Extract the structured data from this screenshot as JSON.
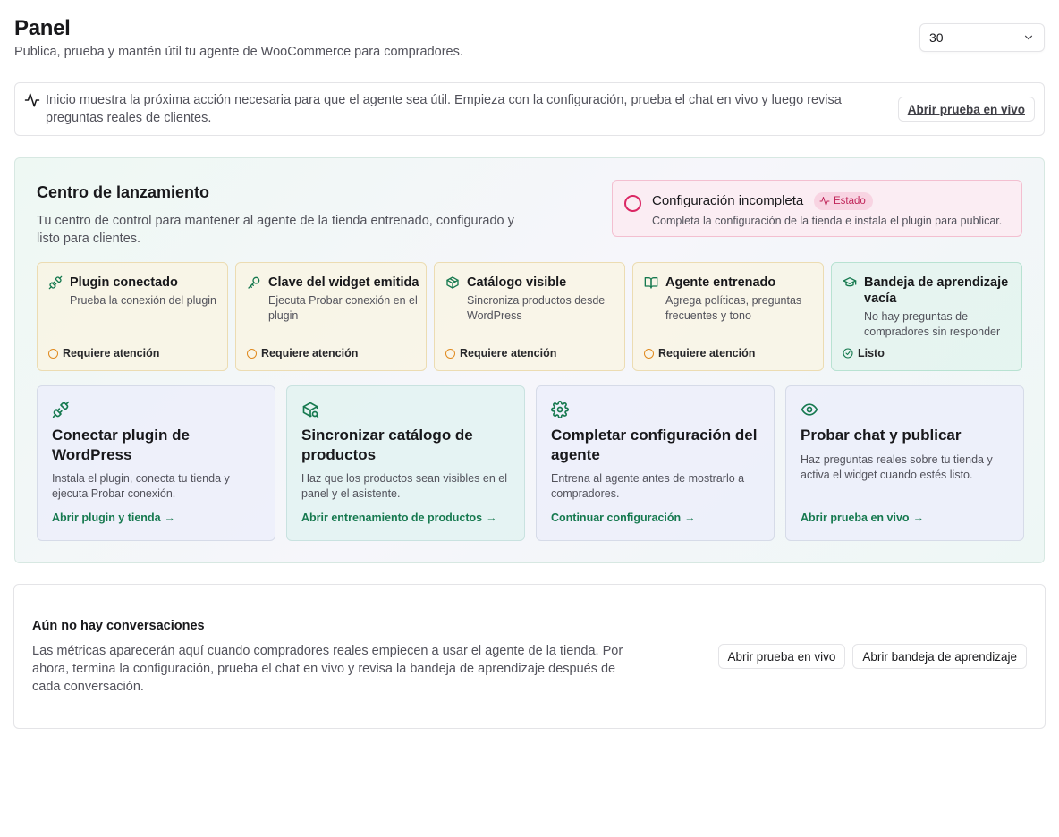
{
  "header": {
    "title": "Panel",
    "subtitle": "Publica, prueba y mantén útil tu agente de WooCommerce para compradores.",
    "range_value": "30"
  },
  "info": {
    "text": "Inicio muestra la próxima acción necesaria para que el agente sea útil. Empieza con la configuración, prueba el chat en vivo y luego revisa preguntas reales de clientes.",
    "button": "Abrir prueba en vivo"
  },
  "launch": {
    "title": "Centro de lanzamiento",
    "description": "Tu centro de control para mantener al agente de la tienda entrenado, configurado y listo para clientes.",
    "status": {
      "title": "Configuración incompleta",
      "badge": "Estado",
      "subtitle": "Completa la configuración de la tienda e instala el plugin para publicar.",
      "color": "#db2764"
    },
    "checks": [
      {
        "icon": "plug-icon",
        "title": "Plugin conectado",
        "description": "Prueba la conexión del plugin",
        "status": "Requiere atención"
      },
      {
        "icon": "key-icon",
        "title": "Clave del widget emitida",
        "description": "Ejecuta Probar conexión en el plugin",
        "status": "Requiere atención"
      },
      {
        "icon": "package-icon",
        "title": "Catálogo visible",
        "description": "Sincroniza productos desde WordPress",
        "status": "Requiere atención"
      },
      {
        "icon": "book-icon",
        "title": "Agente entrenado",
        "description": "Agrega políticas, preguntas frecuentes y tono",
        "status": "Requiere atención"
      },
      {
        "icon": "graduation-cap-icon",
        "title": "Bandeja de aprendizaje vacía",
        "description": "No hay preguntas de compradores sin responder",
        "status": "Listo"
      }
    ],
    "actions": [
      {
        "icon": "plug-icon",
        "title": "Conectar plugin de WordPress",
        "description": "Instala el plugin, conecta tu tienda y ejecuta Probar conexión.",
        "link": "Abrir plugin y tienda"
      },
      {
        "icon": "package-search-icon",
        "title": "Sincronizar catálogo de productos",
        "description": "Haz que los productos sean visibles en el panel y el asistente.",
        "link": "Abrir entrenamiento de productos"
      },
      {
        "icon": "gear-icon",
        "title": "Completar configuración del agente",
        "description": "Entrena al agente antes de mostrarlo a compradores.",
        "link": "Continuar configuración"
      },
      {
        "icon": "eye-icon",
        "title": "Probar chat y publicar",
        "description": "Haz preguntas reales sobre tu tienda y activa el widget cuando estés listo.",
        "link": "Abrir prueba en vivo"
      }
    ],
    "accent_color": "#16794f",
    "warning_color": "#e08a1f"
  },
  "conversations": {
    "title": "Aún no hay conversaciones",
    "description": "Las métricas aparecerán aquí cuando compradores reales empiecen a usar el agente de la tienda. Por ahora, termina la configuración, prueba el chat en vivo y revisa la bandeja de aprendizaje después de cada conversación.",
    "button_live": "Abrir prueba en vivo",
    "button_inbox": "Abrir bandeja de aprendizaje"
  }
}
